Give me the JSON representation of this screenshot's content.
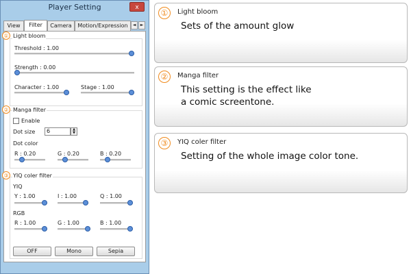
{
  "window": {
    "title": "Player Setting",
    "close_glyph": "x",
    "tabs": [
      "View",
      "Filter",
      "Camera",
      "Motion/Expression"
    ],
    "active_tab": "Filter",
    "scroll_left": "◄",
    "scroll_right": "►"
  },
  "light_bloom": {
    "marker": "①",
    "title": "Light bloom",
    "threshold": {
      "label": "Threshold : 1.00",
      "level": 1.0
    },
    "strength": {
      "label": "Strength : 0.00",
      "level": 0.0
    },
    "character": {
      "label": "Character : 1.00",
      "level": 1.0
    },
    "stage": {
      "label": "Stage : 1.00",
      "level": 1.0
    }
  },
  "manga_filter": {
    "marker": "②",
    "title": "Manga filter",
    "enable_label": "Enable",
    "enable_checked": false,
    "dot_size_label": "Dot size",
    "dot_size_value": "6",
    "dot_color_label": "Dot color",
    "r": {
      "label": "R : 0.20",
      "level": 0.2
    },
    "g": {
      "label": "G : 0.20",
      "level": 0.2
    },
    "b": {
      "label": "B : 0.20",
      "level": 0.2
    }
  },
  "yiq_filter": {
    "marker": "③",
    "title": "YIQ coler filter",
    "yiq_label": "YIQ",
    "y": {
      "label": "Y : 1.00",
      "level": 1.0
    },
    "i": {
      "label": "I : 1.00",
      "level": 1.0
    },
    "q": {
      "label": "Q : 1.00",
      "level": 1.0
    },
    "rgb_label": "RGB",
    "r": {
      "label": "R : 1.00",
      "level": 1.0
    },
    "g": {
      "label": "G : 1.00",
      "level": 1.0
    },
    "b": {
      "label": "B : 1.00",
      "level": 1.0
    },
    "buttons": [
      "OFF",
      "Mono",
      "Sepia"
    ]
  },
  "cards": [
    {
      "marker": "①",
      "title": "Light bloom",
      "desc": [
        "Sets of the amount glow"
      ]
    },
    {
      "marker": "②",
      "title": "Manga filter",
      "desc": [
        "This setting is the effect like",
        "a comic screentone."
      ]
    },
    {
      "marker": "③",
      "title": "YIQ coler filter",
      "desc": [
        "Setting of the whole image color tone."
      ]
    }
  ],
  "colors": {
    "window_bg": "#a9cde9",
    "accent_orange": "#f08a1c",
    "knob": "#5c8fd8",
    "close": "#c7473d"
  }
}
